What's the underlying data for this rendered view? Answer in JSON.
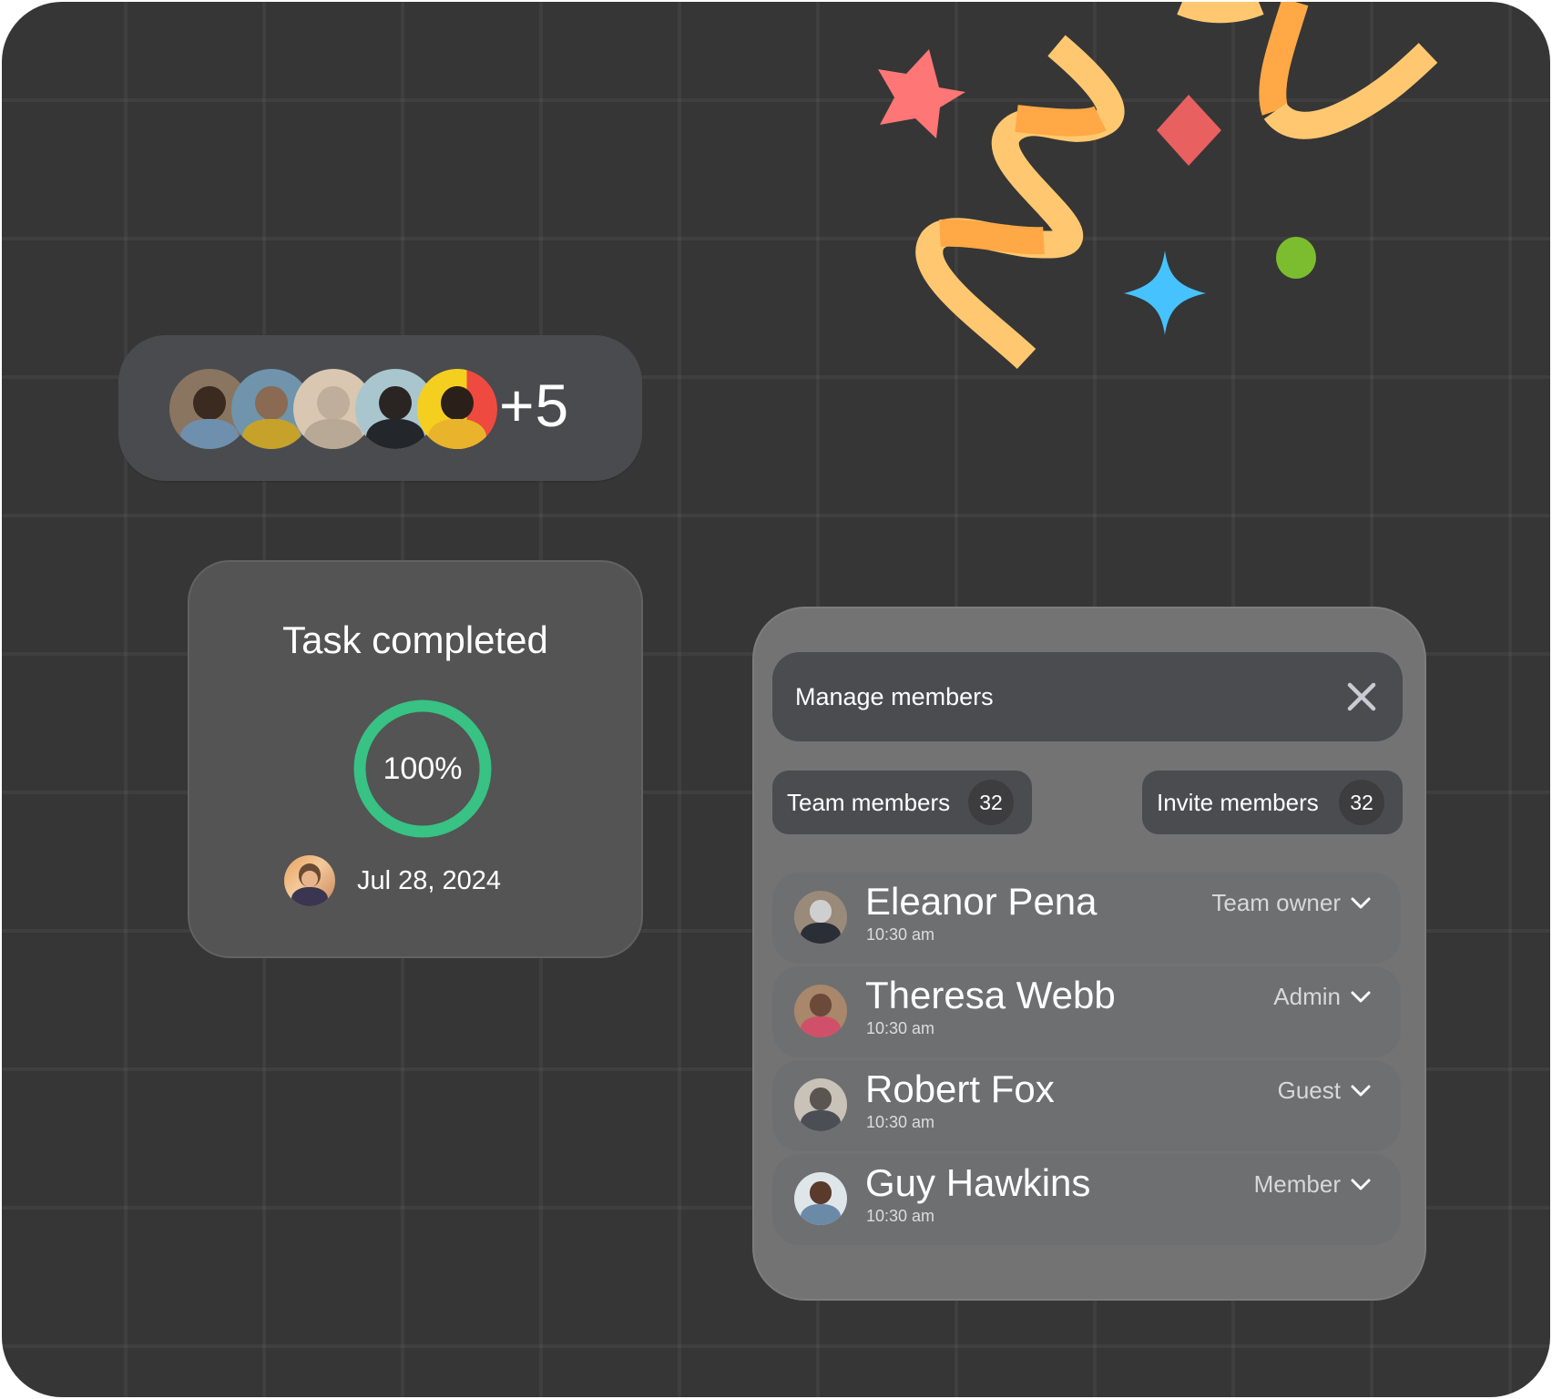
{
  "avatar_group": {
    "overflow_count_label": "+5",
    "avatars": [
      {
        "name": "woman-curly-hair-glasses",
        "colors": {
          "bg": "#8a7560",
          "head": "#3a2a20",
          "body": "#6f8fae"
        }
      },
      {
        "name": "woman-bangs-yellow-shirt",
        "colors": {
          "bg": "#6f94ab",
          "head": "#8a6a52",
          "body": "#c7a22b"
        }
      },
      {
        "name": "woman-hijab",
        "colors": {
          "bg": "#d9c7b2",
          "head": "#bfae9c",
          "body": "#b8a896"
        }
      },
      {
        "name": "woman-long-dark-hair",
        "colors": {
          "bg": "#a9c6cf",
          "head": "#2a2522",
          "body": "#23262b"
        }
      },
      {
        "name": "woman-yellow-sunglasses",
        "colors": {
          "bg": "#f5cf1f",
          "head": "#2b1f1a",
          "body": "#e9b32b",
          "accent": "#ef4a3f"
        }
      }
    ]
  },
  "task_card": {
    "title": "Task completed",
    "progress_label": "100%",
    "progress_fraction": 1.0,
    "progress_color": "#38c283",
    "date": "Jul 28, 2024"
  },
  "members_panel": {
    "title": "Manage members",
    "close_icon": "close-icon",
    "tabs": [
      {
        "label": "Team members",
        "count": "32"
      },
      {
        "label": "Invite members",
        "count": "32"
      }
    ],
    "members": [
      {
        "name": "Eleanor Pena",
        "time": "10:30 am",
        "role": "Team owner",
        "avatar": {
          "bg": "#9a8a7a",
          "head": "#cfcfcf",
          "body": "#2a2e36"
        }
      },
      {
        "name": "Theresa Webb",
        "time": "10:30 am",
        "role": "Admin",
        "avatar": {
          "bg": "#a8876a",
          "head": "#6b4a3a",
          "body": "#d0506a"
        }
      },
      {
        "name": "Robert Fox",
        "time": "10:30 am",
        "role": "Guest",
        "avatar": {
          "bg": "#c9c2b8",
          "head": "#5a5550",
          "body": "#4b4e55"
        }
      },
      {
        "name": "Guy Hawkins",
        "time": "10:30 am",
        "role": "Member",
        "avatar": {
          "bg": "#dfe6ea",
          "head": "#5a3a2a",
          "body": "#6a8aa8"
        }
      }
    ]
  },
  "decorations": {
    "confetti_colors": {
      "star": "#ff7676",
      "diamond": "#e86060",
      "sparkle": "#46c3ff",
      "dot": "#7cbd2f",
      "ribbon_light": "#ffc870",
      "ribbon_dark": "#ffa845"
    }
  }
}
